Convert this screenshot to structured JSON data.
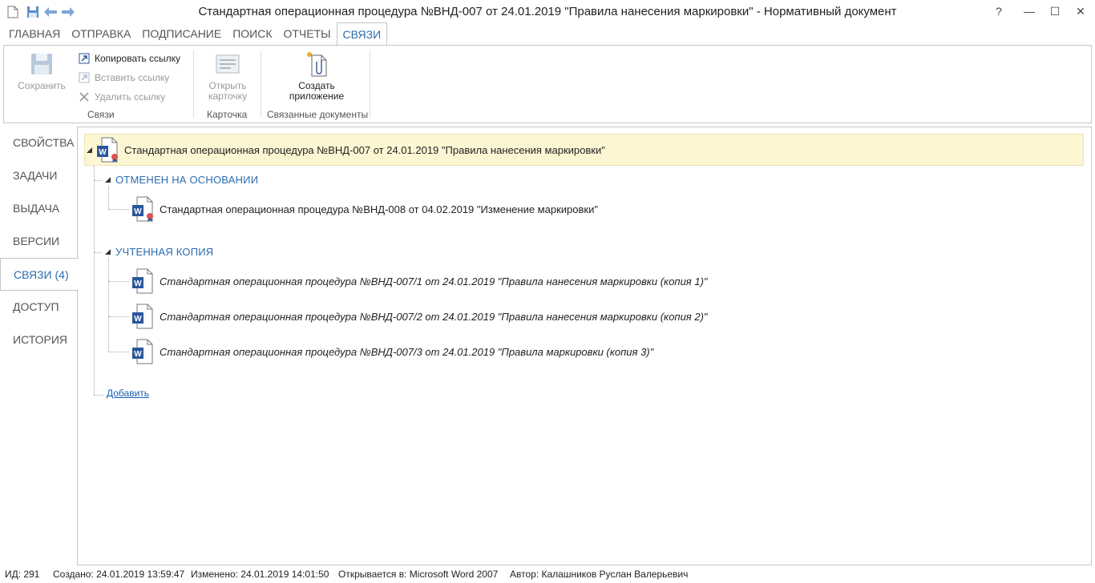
{
  "window": {
    "title": "Стандартная операционная процедура №ВНД-007 от 24.01.2019 \"Правила нанесения маркировки\" - Нормативный документ",
    "help": "?",
    "minimize": "—",
    "maximize": "☐",
    "close": "✕"
  },
  "tabs": [
    {
      "label": "ГЛАВНАЯ"
    },
    {
      "label": "ОТПРАВКА"
    },
    {
      "label": "ПОДПИСАНИЕ"
    },
    {
      "label": "ПОИСК"
    },
    {
      "label": "ОТЧЕТЫ"
    },
    {
      "label": "СВЯЗИ"
    }
  ],
  "ribbon": {
    "save_label": "Сохранить",
    "copy_link": "Копировать ссылку",
    "paste_link": "Вставить ссылку",
    "delete_link": "Удалить ссылку",
    "group_links": "Связи",
    "open_card_line1": "Открыть",
    "open_card_line2": "карточку",
    "group_card": "Карточка",
    "create_attach_line1": "Создать",
    "create_attach_line2": "приложение",
    "group_related": "Связанные документы"
  },
  "nav": [
    {
      "label": "СВОЙСТВА"
    },
    {
      "label": "ЗАДАЧИ"
    },
    {
      "label": "ВЫДАЧА"
    },
    {
      "label": "ВЕРСИИ"
    },
    {
      "label": "СВЯЗИ (4)"
    },
    {
      "label": "ДОСТУП"
    },
    {
      "label": "ИСТОРИЯ"
    }
  ],
  "tree": {
    "root": "Стандартная операционная процедура №ВНД-007 от 24.01.2019 \"Правила нанесения маркировки\"",
    "section1": {
      "title": "ОТМЕНЕН НА ОСНОВАНИИ",
      "items": [
        "Стандартная операционная процедура №ВНД-008 от 04.02.2019 \"Изменение маркировки\""
      ]
    },
    "section2": {
      "title": "УЧТЕННАЯ КОПИЯ",
      "items": [
        "Стандартная операционная процедура №ВНД-007/1 от 24.01.2019 \"Правила нанесения маркировки (копия 1)\"",
        "Стандартная операционная процедура №ВНД-007/2 от 24.01.2019 \"Правила нанесения маркировки (копия 2)\"",
        "Стандартная операционная процедура №ВНД-007/3 от 24.01.2019 \"Правила маркировки (копия 3)\""
      ]
    },
    "add_link": "Добавить"
  },
  "status": {
    "id": "ИД: 291",
    "created": "Создано: 24.01.2019 13:59:47",
    "modified": "Изменено: 24.01.2019 14:01:50",
    "opens_in": "Открывается в: Microsoft Word 2007",
    "author": "Автор: Калашников Руслан Валерьевич"
  },
  "colors": {
    "accent": "#2b6cb0",
    "root_highlight": "#fdf6d3",
    "word_blue": "#2b579a",
    "badge_red": "#d9534f"
  }
}
